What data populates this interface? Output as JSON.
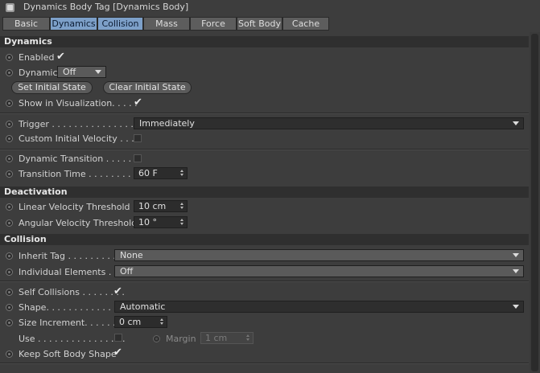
{
  "title": "Dynamics Body Tag [Dynamics Body]",
  "tabs": [
    {
      "label": "Basic",
      "active": false
    },
    {
      "label": "Dynamics",
      "active": true
    },
    {
      "label": "Collision",
      "active": true
    },
    {
      "label": "Mass",
      "active": false
    },
    {
      "label": "Force",
      "active": false
    },
    {
      "label": "Soft Body",
      "active": false
    },
    {
      "label": "Cache",
      "active": false
    }
  ],
  "sections": {
    "dynamics": "Dynamics",
    "deactivation": "Deactivation",
    "collision": "Collision"
  },
  "dynamics": {
    "enabled": {
      "label": "Enabled",
      "checked": true
    },
    "dynamic": {
      "label": "Dynamic",
      "value": "Off"
    },
    "set_initial_state": "Set Initial State",
    "clear_initial_state": "Clear Initial State",
    "show_in_visualization": {
      "label": "Show in Visualization. . . . .",
      "checked": true
    },
    "trigger": {
      "label": "Trigger . . . . . . . . . . . . . . . .",
      "value": "Immediately"
    },
    "custom_initial_velocity": {
      "label": "Custom Initial Velocity . . . .",
      "checked": false
    },
    "dynamic_transition": {
      "label": "Dynamic Transition . . . . . . .",
      "checked": false
    },
    "transition_time": {
      "label": "Transition Time . . . . . . . . . .",
      "value": "60 F"
    }
  },
  "deactivation": {
    "linear_velocity_threshold": {
      "label": "Linear Velocity Threshold",
      "value": "10 cm"
    },
    "angular_velocity_threshold": {
      "label": "Angular Velocity Threshold",
      "value": "10 °"
    }
  },
  "collision": {
    "inherit_tag": {
      "label": "Inherit Tag . . . . . . . . . . .",
      "value": "None"
    },
    "individual_elements": {
      "label": "Individual Elements . . . .",
      "value": "Off"
    },
    "self_collisions": {
      "label": "Self Collisions . . . . . . . .",
      "checked": true
    },
    "shape": {
      "label": "Shape. . . . . . . . . . . . . .",
      "value": "Automatic"
    },
    "size_increment": {
      "label": "Size Increment. . . . . . .",
      "value": "0 cm"
    },
    "use": {
      "label": "Use . . . . . . . . . . . . . . . .",
      "checked": false
    },
    "margin": {
      "label": "Margin",
      "value": "1 cm"
    },
    "keep_soft_body_shape": {
      "label": "Keep Soft Body Shape",
      "checked": true
    }
  },
  "colors": {
    "panel_bg": "#3d3d3d",
    "section_bg": "#2f2f2f",
    "tab_active": "#7da0c9",
    "tab_inactive": "#5d5d5d",
    "field_bg": "#2c2c2c"
  },
  "icons": {
    "title": "dynamics-body-tag-icon",
    "radio": "animation-radio-icon",
    "dropdown": "chevron-down-icon",
    "spinner": "spinner-arrows-icon"
  }
}
